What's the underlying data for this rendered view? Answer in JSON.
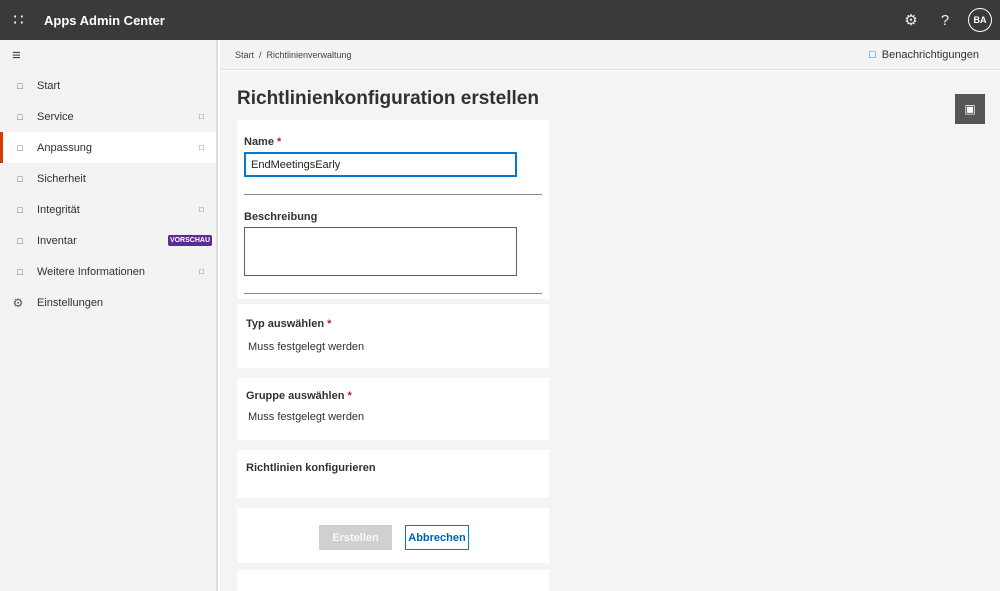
{
  "topbar": {
    "waffle_icon": "waffle-icon",
    "title": "Apps Admin Center",
    "settings_icon": "gear-icon",
    "help_label": "?",
    "avatar_initials": "BA"
  },
  "sidebar": {
    "items": [
      {
        "label": "Start",
        "icon": "home-icon",
        "chevron": false
      },
      {
        "label": "Service",
        "icon": "service-icon",
        "chevron": true
      },
      {
        "label": "Anpassung",
        "icon": "customize-icon",
        "chevron": true,
        "active": true
      },
      {
        "label": "Sicherheit",
        "icon": "security-icon",
        "chevron": false
      },
      {
        "label": "Integrität",
        "icon": "health-icon",
        "chevron": true
      },
      {
        "label": "Inventar",
        "icon": "inventory-icon",
        "badge": "VORSCHAU"
      },
      {
        "label": "Weitere Informationen",
        "icon": "info-icon",
        "chevron": true
      },
      {
        "label": "Einstellungen",
        "icon": "settings-icon",
        "chevron": false
      }
    ]
  },
  "breadcrumb": {
    "text": "Start  /  Richtlinienverwaltung",
    "notifications_label": "Benachrichtigungen"
  },
  "page": {
    "title": "Richtlinienkonfiguration erstellen"
  },
  "form": {
    "name_label": "Name",
    "required_mark": "*",
    "name_value": "EndMeetingsEarly",
    "description_label": "Beschreibung",
    "description_value": "",
    "type_title": "Typ auswählen",
    "type_value": "Muss festgelegt werden",
    "group_title": "Gruppe auswählen",
    "group_value": "Muss festgelegt werden",
    "configure_title": "Richtlinien konfigurieren",
    "create_button": "Erstellen",
    "cancel_button": "Abbrechen"
  },
  "colors": {
    "topbar": "#3a3a3a",
    "accent": "#0078d4",
    "active_indicator": "#d83b01",
    "badge": "#5c2d91"
  }
}
